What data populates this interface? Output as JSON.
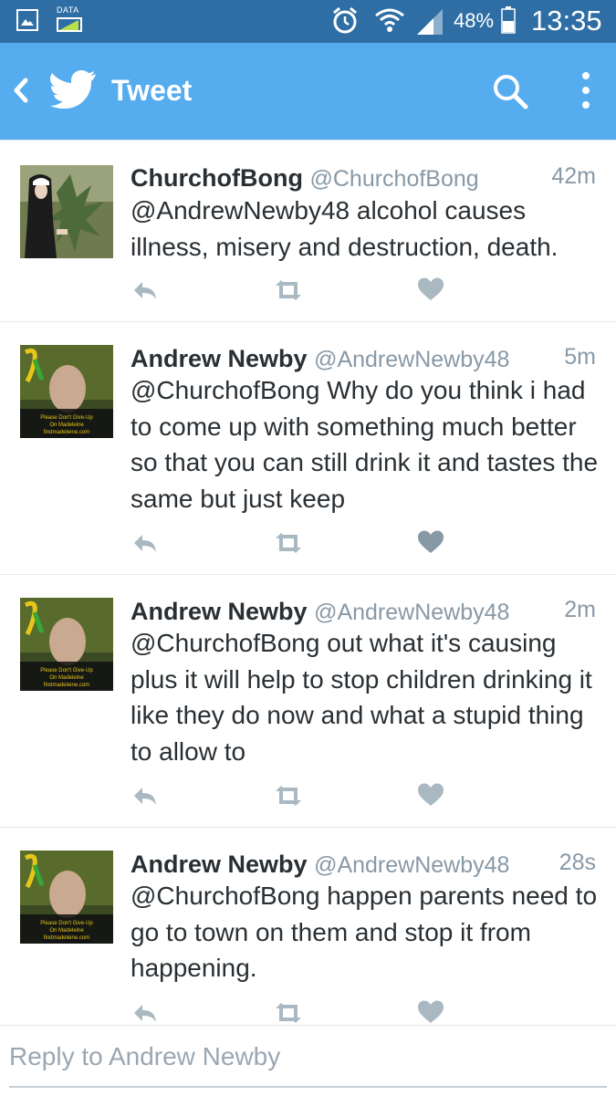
{
  "status_bar": {
    "data_label": "DATA",
    "battery": "48%",
    "time": "13:35"
  },
  "app_bar": {
    "title": "Tweet"
  },
  "tweets": [
    {
      "name": "ChurchofBong",
      "handle": "@ChurchofBong",
      "time": "42m",
      "text": "@AndrewNewby48 alcohol causes illness, misery and destruction, death."
    },
    {
      "name": "Andrew Newby",
      "handle": "@AndrewNewby48",
      "time": "5m",
      "text": "@ChurchofBong Why do you think i had to come up with something much better so that you can still drink it and tastes the same but just keep"
    },
    {
      "name": "Andrew Newby",
      "handle": "@AndrewNewby48",
      "time": "2m",
      "text": "@ChurchofBong out what it's causing plus it will help to stop children drinking it like they do now and what a stupid thing to allow to"
    },
    {
      "name": "Andrew Newby",
      "handle": "@AndrewNewby48",
      "time": "28s",
      "text": "@ChurchofBong happen parents need to go to town on them and stop it from happening."
    }
  ],
  "avatar_caption": [
    "Please Don't Give-Up",
    "On Madeleine",
    "findmadeleine.com"
  ],
  "reply": {
    "placeholder": "Reply to Andrew Newby"
  },
  "colors": {
    "status_bar": "#2f6ea4",
    "app_bar": "#55acee",
    "action_icon": "#aab8c2"
  }
}
